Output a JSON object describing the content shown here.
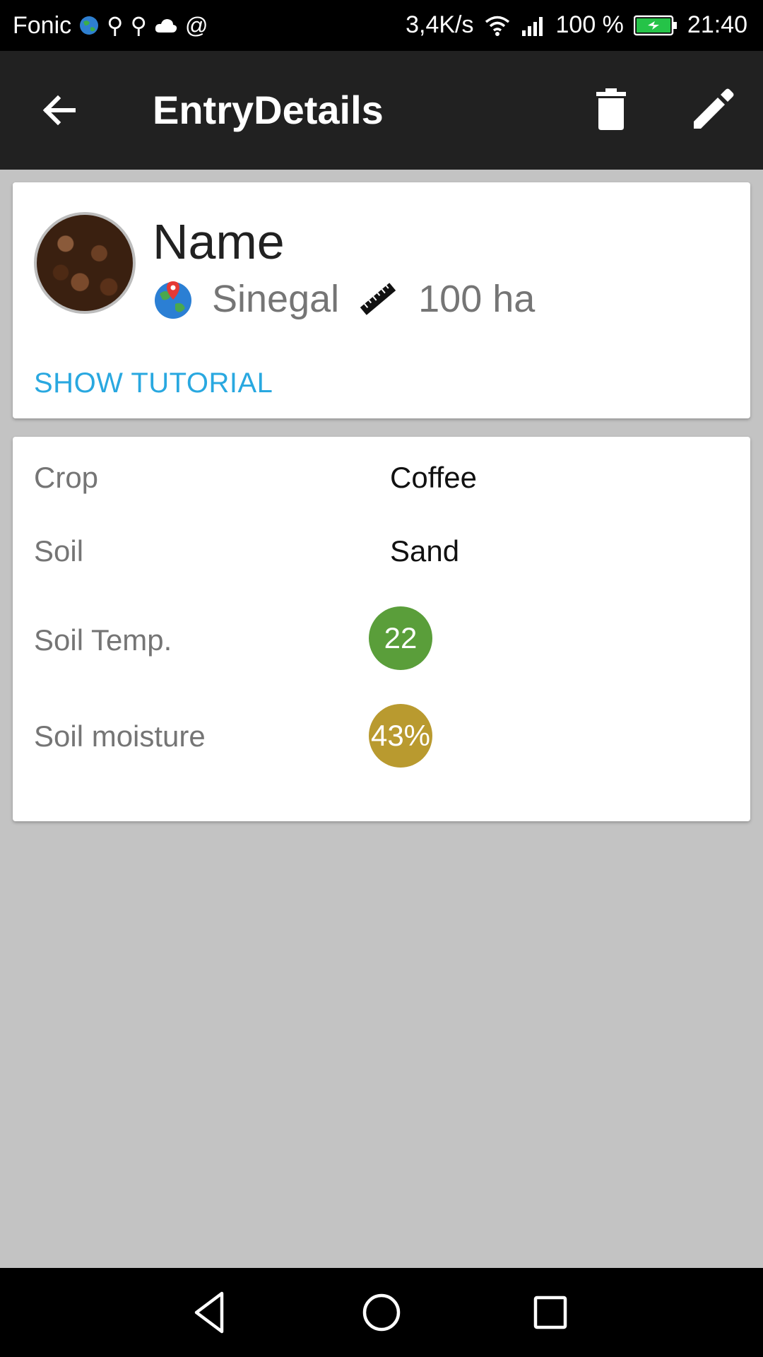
{
  "status_bar": {
    "carrier": "Fonic",
    "speed": "3,4K/s",
    "battery": "100 %",
    "time": "21:40"
  },
  "app_bar": {
    "title": "EntryDetails",
    "icons": [
      "back-arrow-icon",
      "trash-icon",
      "pencil-icon"
    ]
  },
  "entry": {
    "name": "Name",
    "location": "Sinegal",
    "area": "100 ha",
    "tutorial_label": "SHOW TUTORIAL"
  },
  "details": {
    "crop_label": "Crop",
    "crop_value": "Coffee",
    "soil_label": "Soil",
    "soil_value": "Sand",
    "soil_temp_label": "Soil Temp.",
    "soil_temp_value": "22",
    "soil_temp_color": "#5a9e3a",
    "soil_moisture_label": "Soil moisture",
    "soil_moisture_value": "43%",
    "soil_moisture_color": "#b99a2f"
  },
  "colors": {
    "app_bar": "#212121",
    "accent": "#29a8e0",
    "background": "#c3c3c3"
  }
}
